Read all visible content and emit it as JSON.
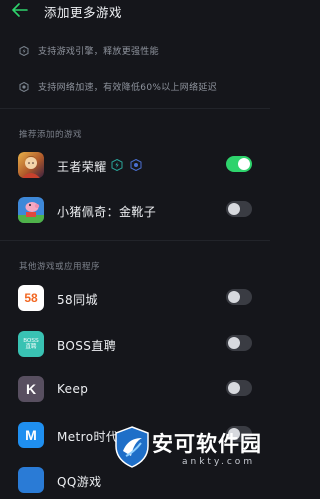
{
  "header": {
    "title": "添加更多游戏"
  },
  "info": [
    {
      "text": "支持游戏引擎，释放更强性能",
      "icon": "boost-icon"
    },
    {
      "text": "支持网络加速，有效降低60%以上网络延迟",
      "icon": "network-icon"
    }
  ],
  "sections": {
    "recommended": "推荐添加的游戏",
    "others": "其他游戏或应用程序"
  },
  "recommended_apps": [
    {
      "name": "王者荣耀",
      "enabled": true,
      "badges": [
        "engine-badge-icon",
        "network-badge-icon"
      ]
    },
    {
      "name": "小猪佩奇：金靴子",
      "enabled": false
    }
  ],
  "other_apps": [
    {
      "name": "58同城",
      "enabled": false,
      "icon_text": "58"
    },
    {
      "name": "BOSS直聘",
      "enabled": false,
      "icon_text": "BOSS 直聘"
    },
    {
      "name": "Keep",
      "enabled": false,
      "icon_text": "K"
    },
    {
      "name": "Metro时代",
      "enabled": false,
      "icon_text": "M"
    },
    {
      "name": "QQ游戏",
      "enabled": false
    }
  ],
  "watermark": {
    "text": "安可软件园",
    "url": "ankty.com"
  },
  "colors": {
    "background": "#15161b",
    "accent_green": "#2ed36c",
    "text_primary": "#eceef1",
    "text_secondary": "#8e939d"
  }
}
